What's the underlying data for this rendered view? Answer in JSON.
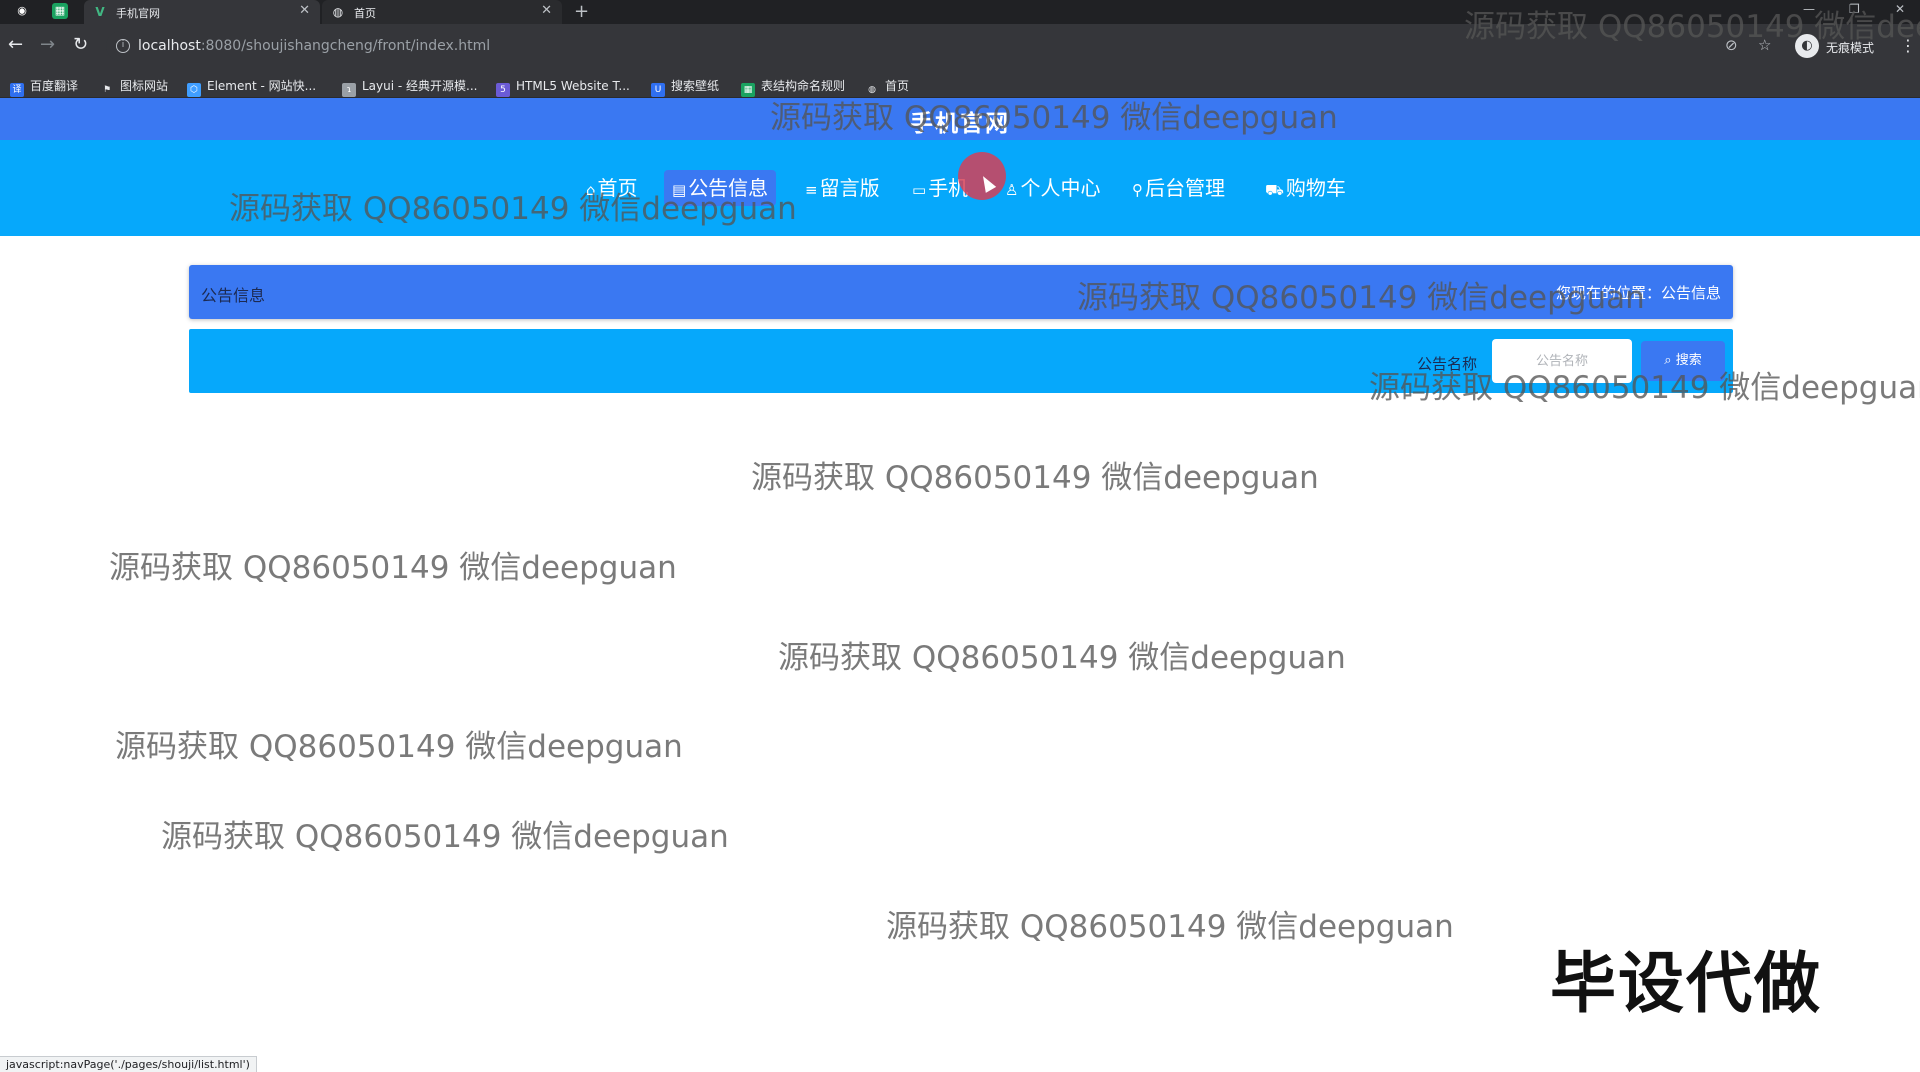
{
  "browser": {
    "tabs": [
      {
        "title": "手机官网",
        "favicon": "vue-icon"
      },
      {
        "title": "首页",
        "favicon": "globe-icon"
      }
    ],
    "url_host": "localhost",
    "url_path": ":8080/shoujishangcheng/front/index.html",
    "incognito_label": "无痕模式",
    "bookmarks": [
      {
        "label": "百度翻译",
        "icon": "baidu-translate-icon",
        "color": "#2f6ff0"
      },
      {
        "label": "图标网站",
        "icon": "flag-icon",
        "color": "#e8eaed"
      },
      {
        "label": "Element - 网站快...",
        "icon": "element-icon",
        "color": "#409eff"
      },
      {
        "label": "Layui - 经典开源模...",
        "icon": "layui-icon",
        "color": "#9aa0a6"
      },
      {
        "label": "HTML5 Website T...",
        "icon": "html5-icon",
        "color": "#6b5bd6"
      },
      {
        "label": "搜索壁纸",
        "icon": "wallpaper-icon",
        "color": "#2f6ff0"
      },
      {
        "label": "表结构命名规则",
        "icon": "sheet-icon",
        "color": "#1aa260"
      },
      {
        "label": "首页",
        "icon": "globe-icon",
        "color": "#e8eaed"
      }
    ],
    "status_url": "javascript:navPage('./pages/shouji/list.html')"
  },
  "site": {
    "title": "手机官网",
    "nav": [
      {
        "label": "首页",
        "icon": "home-icon",
        "active": false
      },
      {
        "label": "公告信息",
        "icon": "notice-icon",
        "active": true
      },
      {
        "label": "留言版",
        "icon": "message-icon",
        "active": false
      },
      {
        "label": "手机",
        "icon": "book-icon",
        "active": false
      },
      {
        "label": "个人中心",
        "icon": "user-icon",
        "active": false
      },
      {
        "label": "后台管理",
        "icon": "link-icon",
        "active": false
      },
      {
        "label": "购物车",
        "icon": "cart-icon",
        "active": false
      }
    ]
  },
  "notice": {
    "title": "公告信息",
    "breadcrumb": "您现在的位置：公告信息",
    "search_label": "公告名称",
    "search_placeholder": "公告名称",
    "search_button": "搜索"
  },
  "overlay": {
    "watermark": "源码获取 QQ86050149 微信deepguan",
    "promo": "毕设代做"
  },
  "colors": {
    "title_bar": "#3a78f2",
    "nav_bar": "#06a8fb",
    "active_nav": "#3a78f2",
    "search_button": "#3a78f2"
  }
}
